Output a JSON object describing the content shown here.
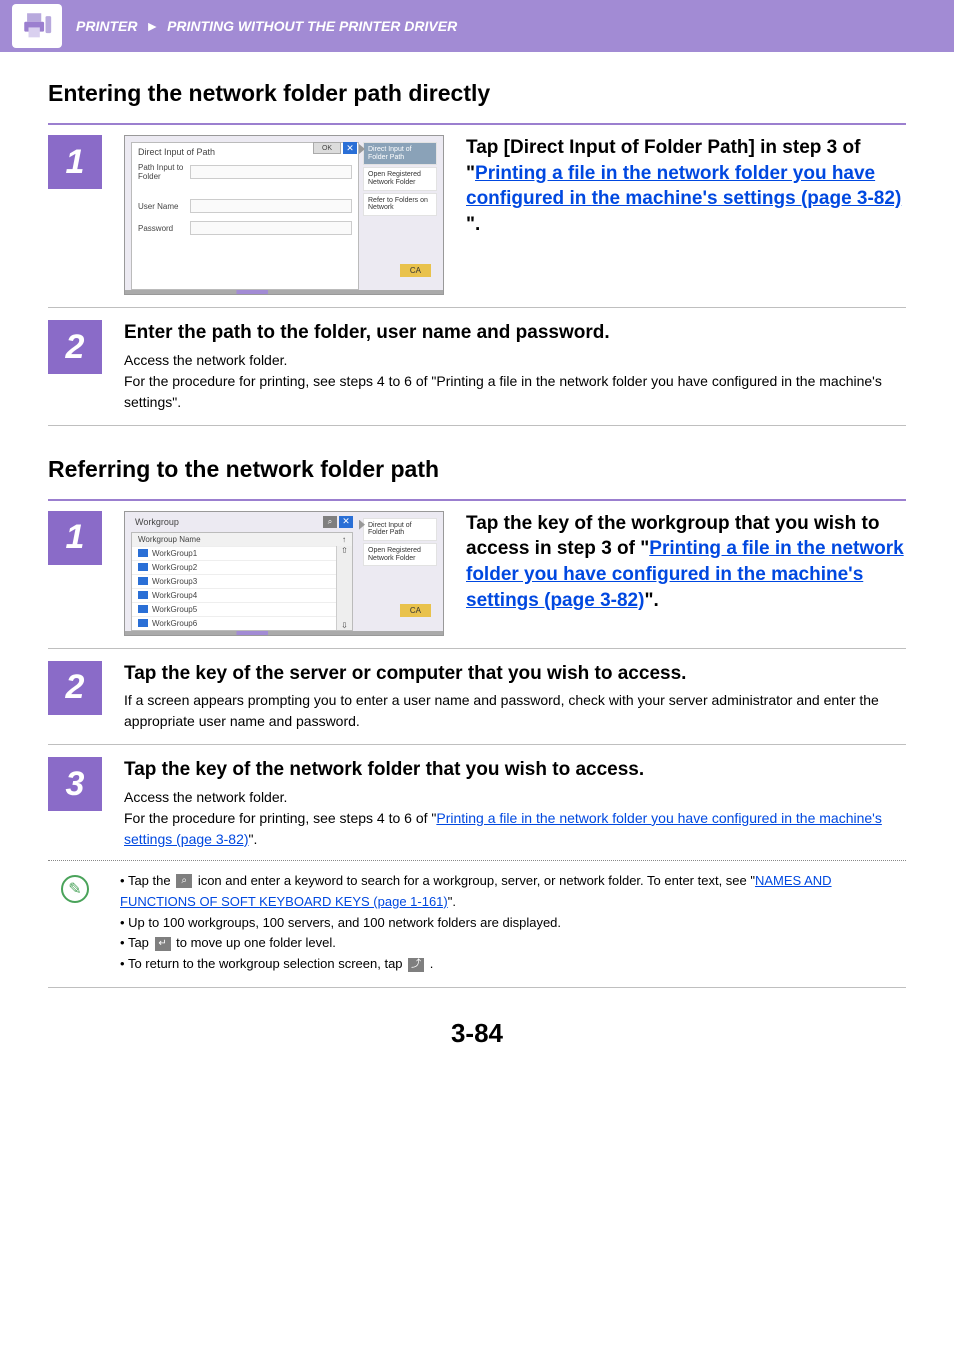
{
  "header": {
    "section": "PRINTER",
    "subsection": "PRINTING WITHOUT THE PRINTER DRIVER"
  },
  "sectionA": {
    "title": "Entering the network folder path directly",
    "step1": {
      "num": "1",
      "lead": "Tap [Direct Input of Folder Path] in step 3 of \"",
      "link": "Printing a file in the network folder you have configured in the machine's settings (page 3-82)",
      "tail": " \"."
    },
    "step2": {
      "num": "2",
      "title": "Enter the path to the folder, user name and password.",
      "body1": "Access the network folder.",
      "body2": "For the procedure for printing, see steps 4 to 6 of \"Printing a file in the network folder you have configured in the machine's settings\"."
    }
  },
  "sectionB": {
    "title": "Referring to the network folder path",
    "step1": {
      "num": "1",
      "lead": "Tap the key of the workgroup that you wish to access in step 3 of \"",
      "link": "Printing a file in the network folder you have configured in the machine's settings (page 3-82)",
      "tail": "\"."
    },
    "step2": {
      "num": "2",
      "title": "Tap the key of the server or computer that you wish to access.",
      "body": "If a screen appears prompting you to enter a user name and password, check with your server administrator and enter the appropriate user name and password."
    },
    "step3": {
      "num": "3",
      "title": "Tap the key of the network folder that you wish to access.",
      "body1": "Access the network folder.",
      "body2a": "For the procedure for printing, see steps 4 to 6 of \"",
      "body2link": "Printing a file in the network folder you have configured in the machine's settings (page 3-82)",
      "body2b": "\"."
    }
  },
  "notes": {
    "b1a": "Tap the ",
    "b1b": " icon and enter a keyword to search for a workgroup, server, or network folder. To enter text, see \"",
    "b1link": "NAMES AND FUNCTIONS OF SOFT KEYBOARD KEYS (page 1-161)",
    "b1c": "\".",
    "b2": "Up to 100 workgroups, 100 servers, and 100 network folders are displayed.",
    "b3a": "Tap ",
    "b3b": " to move up one folder level.",
    "b4a": "To return to the workgroup selection screen, tap ",
    "b4b": " ."
  },
  "panel1": {
    "title": "Direct Input of Path",
    "ok": "OK",
    "lbl_path": "Path Input to Folder",
    "lbl_user": "User Name",
    "lbl_pass": "Password",
    "side1": "Direct Input of Folder Path",
    "side2": "Open Registered Network Folder",
    "side3": "Refer to Folders on Network",
    "ca": "CA"
  },
  "panel2": {
    "title": "Workgroup",
    "colhead": "Workgroup Name",
    "items": [
      "WorkGroup1",
      "WorkGroup2",
      "WorkGroup3",
      "WorkGroup4",
      "WorkGroup5",
      "WorkGroup6"
    ],
    "side1": "Direct Input of Folder Path",
    "side2": "Open Registered Network Folder",
    "ca": "CA"
  },
  "pageNumber": "3-84"
}
